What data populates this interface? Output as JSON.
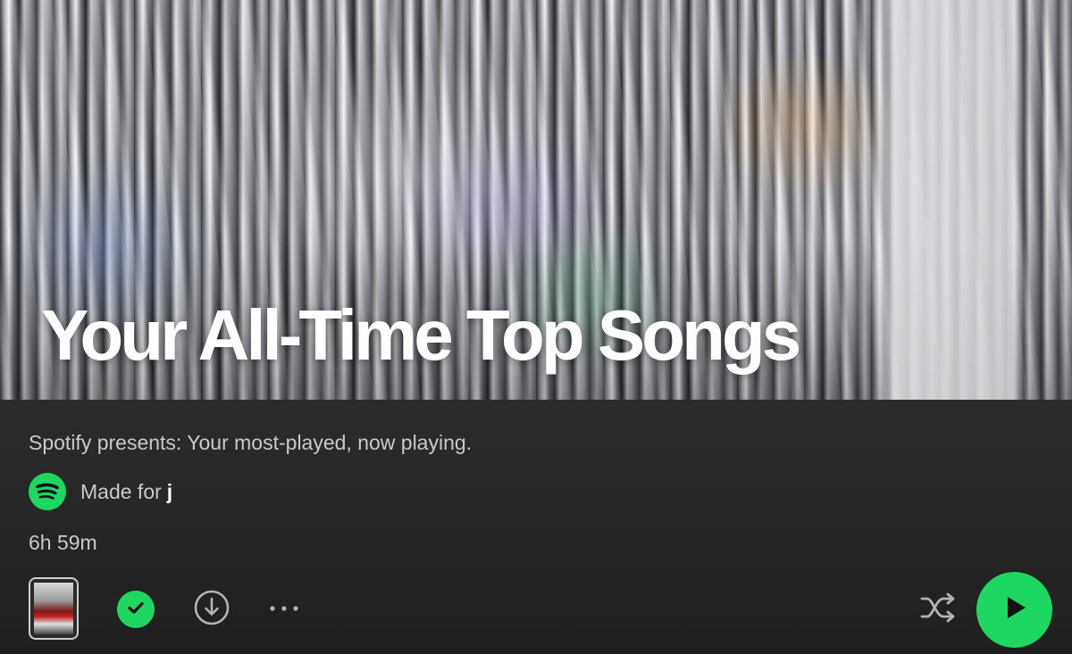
{
  "playlist": {
    "title": "Your All-Time Top Songs",
    "description": "Spotify presents: Your most-played, now playing.",
    "made_for_label": "Made for",
    "made_for_user": "j",
    "duration": "6h 59m"
  },
  "icons": {
    "brand": "spotify-logo-icon",
    "saved": "check-circle-icon",
    "download": "download-icon",
    "more": "more-icon",
    "shuffle": "shuffle-icon",
    "play": "play-icon"
  },
  "colors": {
    "accent": "#1ed760",
    "background": "#1f1f1f",
    "secondary_text": "#c9c9c9"
  }
}
